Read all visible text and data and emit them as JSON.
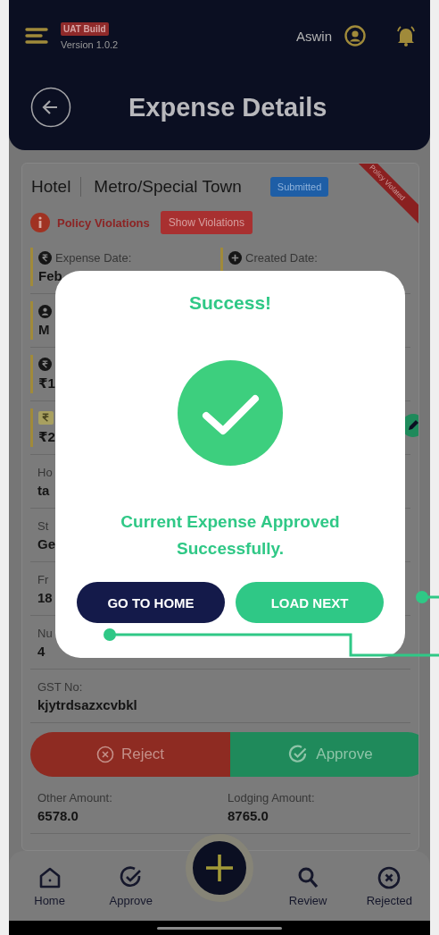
{
  "header": {
    "build_badge": "UAT Build",
    "version": "Version 1.0.2",
    "user_name": "Aswin"
  },
  "page_title": "Expense Details",
  "expense": {
    "category": "Hotel",
    "city_type": "Metro/Special Town",
    "status": "Submitted",
    "ribbon": "Policy Violated",
    "policy_label": "Policy Violations",
    "violations_button": "Show Violations"
  },
  "rows": [
    {
      "editable": false,
      "cells": [
        {
          "kind": "rupee",
          "label": "Expense Date:",
          "value": "Feb",
          "accent": true
        },
        {
          "kind": "plus",
          "label": "Created Date:",
          "accent": true
        }
      ]
    },
    {
      "editable": false,
      "cells": [
        {
          "kind": "user",
          "value": "M",
          "accent": true
        }
      ]
    },
    {
      "editable": false,
      "cells": [
        {
          "kind": "rupee",
          "value": "₹1",
          "accent": true
        }
      ]
    },
    {
      "editable": true,
      "cells": [
        {
          "kind": "tag",
          "value": "₹2",
          "accent": true
        }
      ]
    },
    {
      "editable": false,
      "cells": [
        {
          "label": "Ho",
          "value": "ta",
          "accent": false
        }
      ]
    },
    {
      "editable": false,
      "cells": [
        {
          "label": "St",
          "value": "Ge",
          "accent": false
        }
      ]
    },
    {
      "editable": false,
      "cells": [
        {
          "label": "Fr",
          "value": "18",
          "accent": false
        }
      ]
    },
    {
      "editable": false,
      "cells": [
        {
          "label": "Nu",
          "value": "4",
          "accent": false
        }
      ]
    },
    {
      "editable": false,
      "cells": [
        {
          "label": "GST No:",
          "value": "kjytrdsazxcvbkl",
          "accent": false
        }
      ]
    }
  ],
  "actions": [
    {
      "kind": "reject",
      "label": "Reject"
    },
    {
      "kind": "approve",
      "label": "Approve"
    }
  ],
  "rows_after": [
    {
      "editable": false,
      "cells": [
        {
          "label": "Other Amount:",
          "value": "6578.0",
          "accent": false
        },
        {
          "label": "Lodging Amount:",
          "value": "8765.0",
          "accent": false
        }
      ]
    }
  ],
  "nav": [
    {
      "kind": "home",
      "label": "Home"
    },
    {
      "kind": "approve",
      "label": "Approve"
    },
    {
      "kind": "add"
    },
    {
      "kind": "review",
      "label": "Review"
    },
    {
      "kind": "rejected",
      "label": "Rejected"
    }
  ],
  "modal": {
    "title": "Success!",
    "message": "Current Expense Approved Successfully.",
    "buttons": [
      {
        "kind": "secondary",
        "label": "GO TO HOME"
      },
      {
        "kind": "primary",
        "label": "LOAD NEXT"
      }
    ]
  }
}
